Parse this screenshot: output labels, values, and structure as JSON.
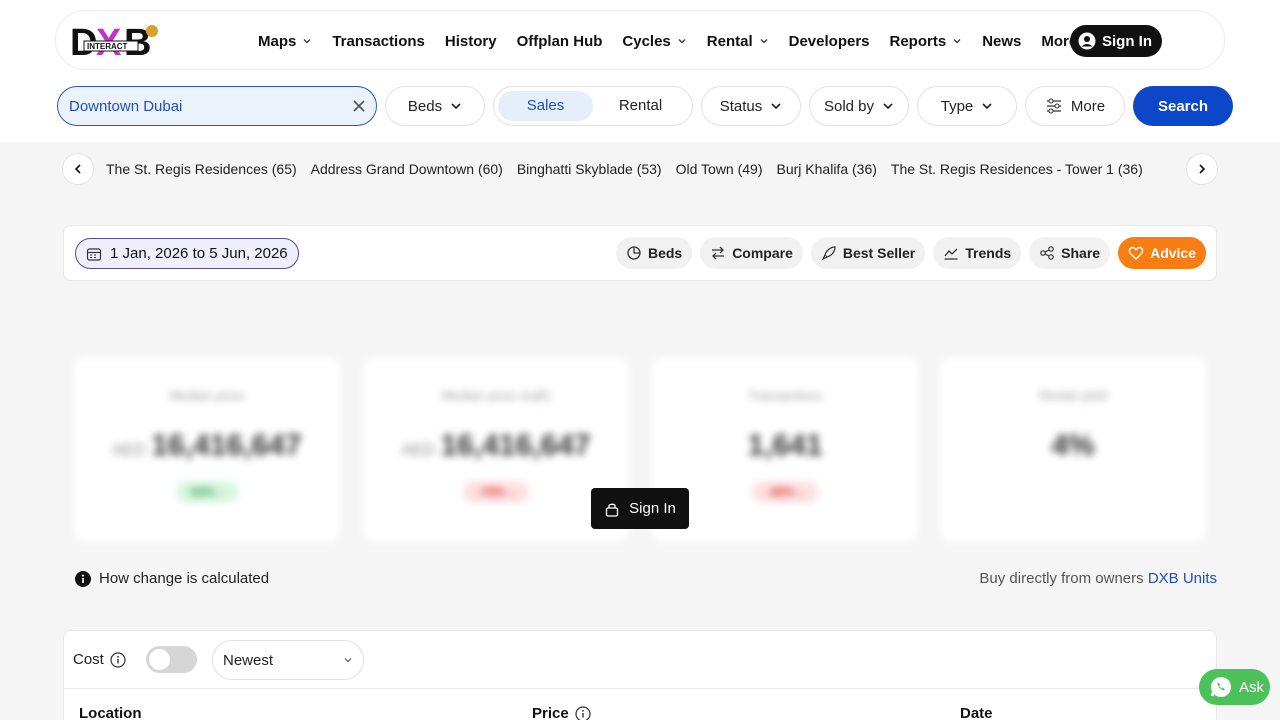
{
  "brand": {
    "logo_text": "DXB",
    "logo_sub": "INTERACT"
  },
  "nav": {
    "items": [
      {
        "label": "Maps",
        "dropdown": true
      },
      {
        "label": "Transactions",
        "dropdown": false
      },
      {
        "label": "History",
        "dropdown": false
      },
      {
        "label": "Offplan Hub",
        "dropdown": false
      },
      {
        "label": "Cycles",
        "dropdown": true
      },
      {
        "label": "Rental",
        "dropdown": true
      },
      {
        "label": "Developers",
        "dropdown": false
      },
      {
        "label": "Reports",
        "dropdown": true
      },
      {
        "label": "News",
        "dropdown": false
      },
      {
        "label": "More",
        "dropdown": true
      }
    ],
    "signin_label": "Sign In"
  },
  "filters": {
    "search_value": "Downtown Dubai",
    "beds_label": "Beds",
    "sales_label": "Sales",
    "rental_label": "Rental",
    "status_label": "Status",
    "soldby_label": "Sold by",
    "type_label": "Type",
    "more_label": "More",
    "search_button": "Search"
  },
  "buildings": [
    "The St. Regis Residences (65)",
    "Address Grand Downtown (60)",
    "Binghatti Skyblade (53)",
    "Old Town (49)",
    "Burj Khalifa (36)",
    "The St. Regis Residences - Tower 1 (36)"
  ],
  "toolbar": {
    "date_range": "1 Jan, 2026 to 5 Jun, 2026",
    "beds": "Beds",
    "compare": "Compare",
    "best_seller": "Best Seller",
    "trends": "Trends",
    "share": "Share",
    "advice": "Advice"
  },
  "stats": [
    {
      "label": "Median price",
      "currency": "AED",
      "value": "16,416,647",
      "change": "54% ↑",
      "direction": "up"
    },
    {
      "label": "Median price (sqft)",
      "currency": "AED",
      "value": "16,416,647",
      "change": "-78% ↓",
      "direction": "down"
    },
    {
      "label": "Transactions",
      "currency": "",
      "value": "1,641",
      "change": "-48% ↓",
      "direction": "down"
    },
    {
      "label": "Rental yield",
      "currency": "",
      "value": "4%",
      "change": "",
      "direction": ""
    }
  ],
  "overlay_signin": "Sign In",
  "info": {
    "how_change": "How change is calculated",
    "buy_prefix": "Buy directly from owners",
    "buy_link": "DXB Units"
  },
  "table": {
    "cost_label": "Cost",
    "sort_value": "Newest",
    "columns": {
      "location": "Location",
      "price": "Price",
      "date": "Date"
    }
  },
  "ask_label": "Ask",
  "colors": {
    "accent": "#0d47c9",
    "advice": "#f97d12",
    "whatsapp": "#4cc15a"
  }
}
